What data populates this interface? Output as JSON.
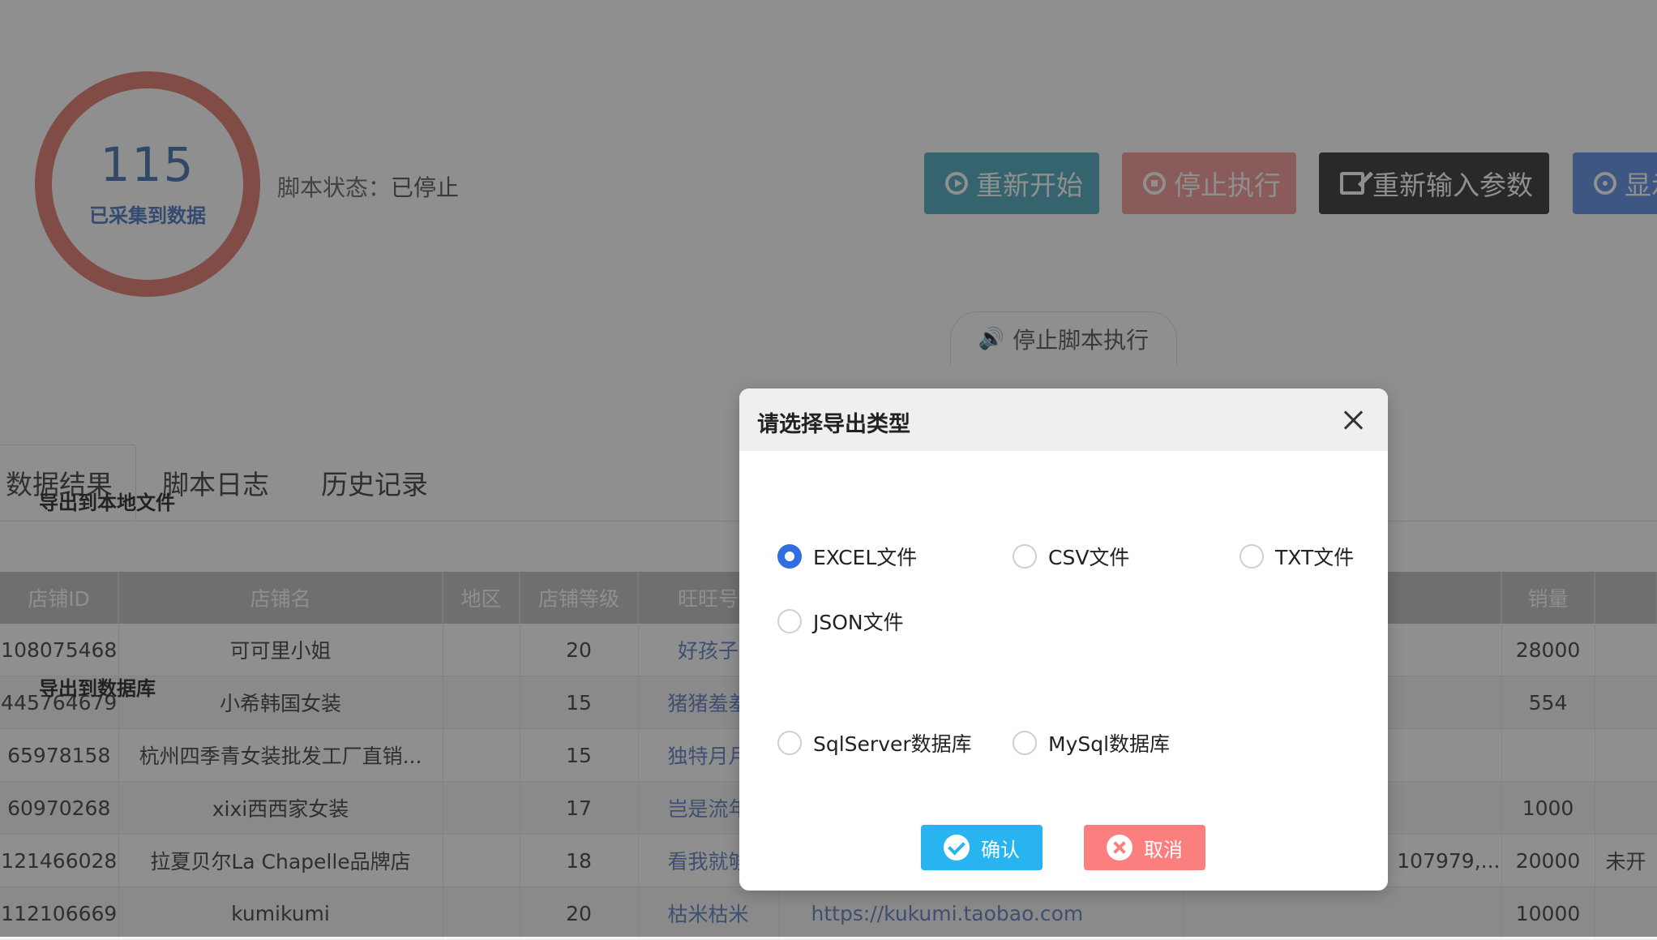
{
  "status_ring": {
    "count": "115",
    "label": "已采集到数据"
  },
  "script_status": {
    "label": "脚本状态：",
    "value": "已停止"
  },
  "toolbar": {
    "restart_label": "重新开始",
    "stop_label": "停止执行",
    "reinput_label": "重新输入参数",
    "show_label": "显示"
  },
  "stop_script_label": "停止脚本执行",
  "tabs": [
    {
      "label": "数据结果"
    },
    {
      "label": "脚本日志"
    },
    {
      "label": "历史记录"
    }
  ],
  "table": {
    "headers": [
      "店铺ID",
      "店铺名",
      "地区",
      "店铺等级",
      "旺旺号",
      "",
      "",
      "销量",
      ""
    ],
    "rows": [
      [
        "108075468",
        "可可里小姐",
        "",
        "20",
        "好孩子",
        "",
        "",
        "28000",
        ""
      ],
      [
        "445764679",
        "小希韩国女装",
        "",
        "15",
        "猪猪羞羞",
        "",
        "",
        "554",
        ""
      ],
      [
        "65978158",
        "杭州四季青女装批发工厂直销...",
        "",
        "15",
        "独特月月",
        "",
        "",
        "",
        ""
      ],
      [
        "60970268",
        "xixi西西家女装",
        "",
        "17",
        "岂是流年",
        "",
        "",
        "1000",
        ""
      ],
      [
        "121466028",
        "拉夏贝尔La Chapelle品牌店",
        "",
        "18",
        "看我就够",
        "",
        "107979,...",
        "20000",
        "未开"
      ],
      [
        "112106669",
        "kumikumi",
        "",
        "20",
        "枯米枯米",
        "https://kukumi.taobao.com",
        "",
        "10000",
        ""
      ]
    ]
  },
  "modal": {
    "title": "请选择导出类型",
    "local_section": "导出到本地文件",
    "local_options": [
      "EXCEL文件",
      "CSV文件",
      "TXT文件",
      "JSON文件"
    ],
    "db_section": "导出到数据库",
    "db_options": [
      "SqlServer数据库",
      "MySql数据库"
    ],
    "selected": "EXCEL文件",
    "confirm_label": "确认",
    "cancel_label": "取消"
  },
  "colors": {
    "accent": "#2f6de0",
    "confirm": "#27b4f0",
    "cancel": "#fb7f7f",
    "ring": "#e4887b",
    "restart": "#5fb3c4",
    "stop": "#f4a2a2",
    "reinput": "#4a4a4a",
    "show": "#6e99e8"
  }
}
